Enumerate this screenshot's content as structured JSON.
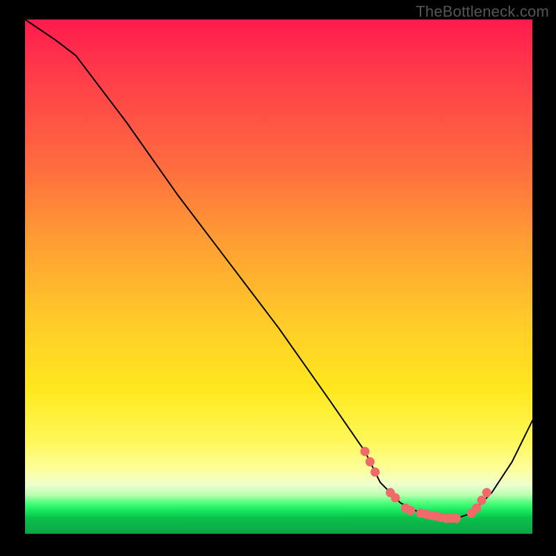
{
  "watermark": "TheBottleneck.com",
  "chart_data": {
    "type": "line",
    "title": "",
    "xlabel": "",
    "ylabel": "",
    "xlim": [
      0,
      100
    ],
    "ylim": [
      0,
      100
    ],
    "series": [
      {
        "name": "curve",
        "x": [
          0,
          6,
          10,
          20,
          30,
          40,
          50,
          60,
          67,
          70,
          74,
          78,
          82,
          85,
          88,
          92,
          96,
          100
        ],
        "y": [
          100,
          96,
          93,
          80,
          66,
          53,
          40,
          26,
          16,
          10,
          6,
          4,
          3,
          3,
          4,
          8,
          14,
          22
        ]
      }
    ],
    "markers": {
      "name": "highlighted-points",
      "color": "#f06a6a",
      "x": [
        67,
        68,
        69,
        72,
        73,
        75,
        76,
        78,
        79,
        80,
        81,
        82,
        83,
        84,
        85,
        88,
        89,
        90,
        91
      ],
      "y": [
        16,
        14,
        12,
        8,
        7,
        5,
        4.5,
        4,
        3.8,
        3.6,
        3.4,
        3.2,
        3,
        3,
        3,
        4,
        5,
        6.5,
        8
      ]
    },
    "background": {
      "type": "vertical-gradient",
      "stops": [
        {
          "pos": 0.0,
          "color": "#ff1a4d"
        },
        {
          "pos": 0.28,
          "color": "#ff6a3f"
        },
        {
          "pos": 0.58,
          "color": "#ffc928"
        },
        {
          "pos": 0.88,
          "color": "#fdff9d"
        },
        {
          "pos": 0.94,
          "color": "#4dff7a"
        },
        {
          "pos": 1.0,
          "color": "#0aa646"
        }
      ]
    }
  }
}
